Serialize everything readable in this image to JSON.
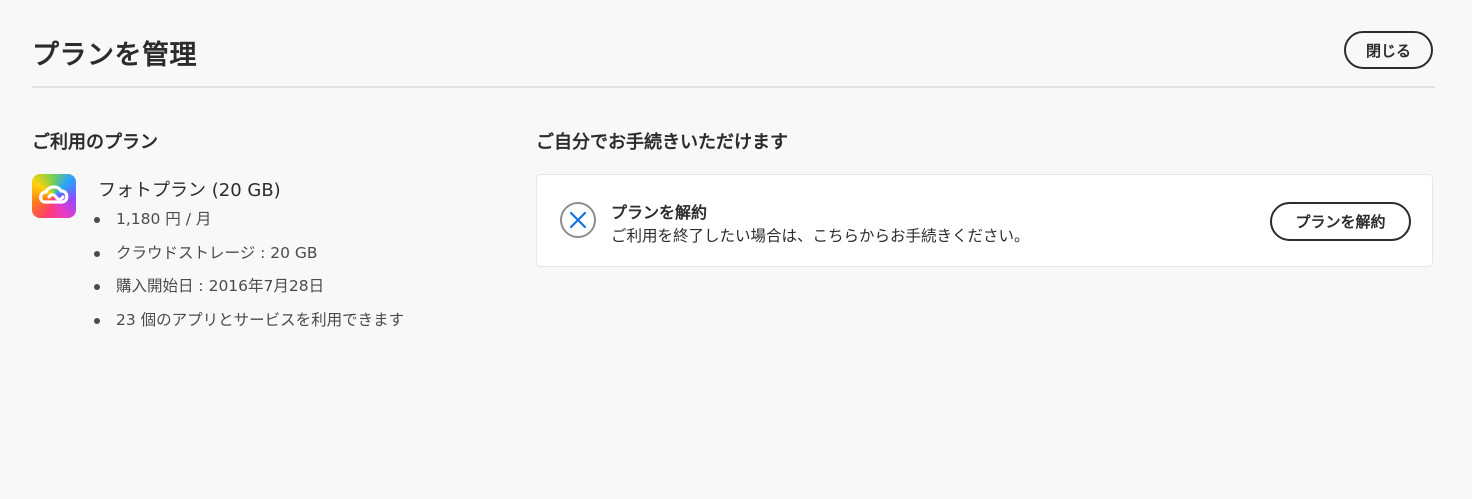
{
  "header": {
    "title": "プランを管理",
    "close_label": "閉じる"
  },
  "current_plan": {
    "heading": "ご利用のプラン",
    "icon": "creative-cloud-icon",
    "name": "フォトプラン (20 GB)",
    "details": [
      "1,180 円 / 月",
      "クラウドストレージ : 20 GB",
      "購入開始日 : 2016年7月28日",
      "23 個のアプリとサービスを利用できます"
    ]
  },
  "self_service": {
    "heading": "ご自分でお手続きいただけます",
    "cancel_card": {
      "icon": "cancel-circle-icon",
      "title": "プランを解約",
      "description": "ご利用を終了したい場合は、こちらからお手続きください。",
      "button_label": "プランを解約"
    }
  },
  "colors": {
    "background": "#f8f8f8",
    "text": "#2c2c2c",
    "divider": "#e1e1e1",
    "cancel_icon_accent": "#1473e6"
  }
}
